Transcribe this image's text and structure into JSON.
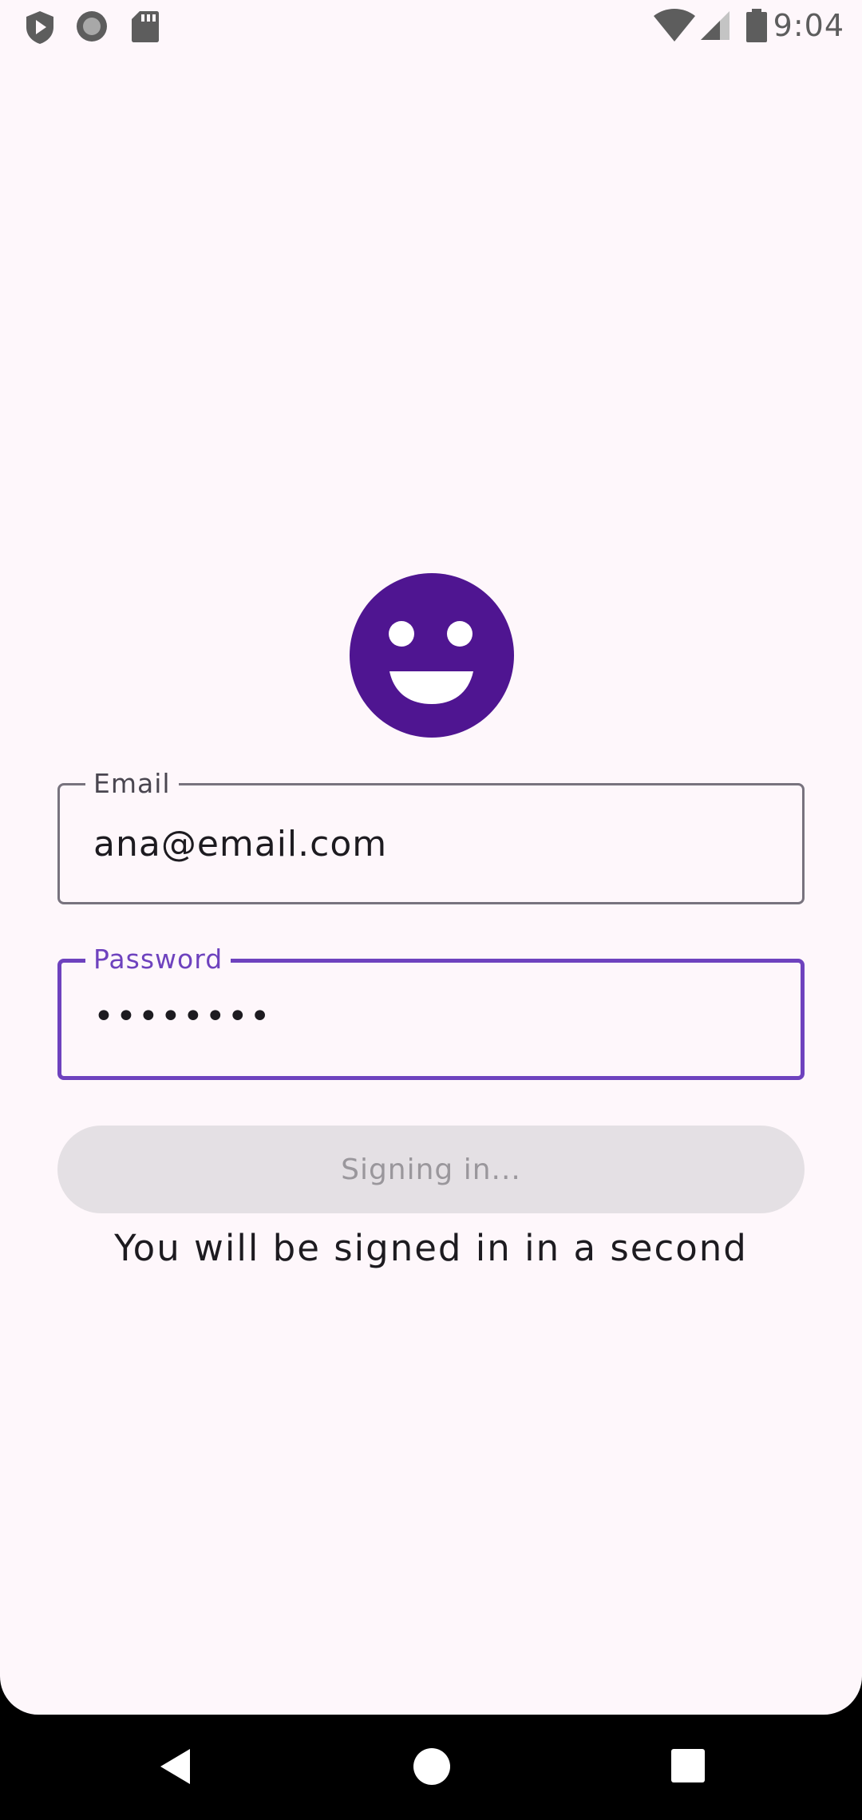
{
  "status_bar": {
    "time": "9:04",
    "left_icons": [
      "play-shield-icon",
      "record-icon",
      "sd-card-icon"
    ],
    "right_icons": [
      "wifi-icon",
      "signal-icon",
      "battery-icon"
    ]
  },
  "logo": {
    "icon": "smiley-face-icon",
    "color": "#4f1591"
  },
  "form": {
    "email_label": "Email",
    "email_value": "ana@email.com",
    "password_label": "Password",
    "password_value": "••••••••",
    "signin_label": "Signing in...",
    "status_message": "You will be signed in in a second"
  },
  "colors": {
    "background": "#fef7fb",
    "accent": "#6e42be",
    "button_disabled_bg": "#e4e0e4",
    "button_disabled_text": "#9a979c"
  },
  "nav_bar": {
    "icons": [
      "back-icon",
      "home-icon",
      "recents-icon"
    ]
  }
}
